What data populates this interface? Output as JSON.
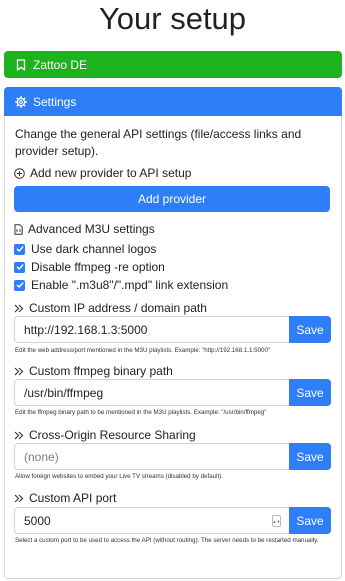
{
  "page": {
    "title": "Your setup"
  },
  "provider_card": {
    "label": "Zattoo DE",
    "icon": "bookmark-icon",
    "color": "#1db31d"
  },
  "settings_card": {
    "label": "Settings",
    "icon": "gear-icon",
    "color": "#2d7ef7",
    "description": "Change the general API settings (file/access links and provider setup).",
    "add_provider_heading": "Add new provider to API setup",
    "add_provider_button": "Add provider",
    "advanced_heading": "Advanced M3U settings",
    "checkboxes": [
      {
        "label": "Use dark channel logos",
        "checked": true
      },
      {
        "label": "Disable ffmpeg -re option",
        "checked": true
      },
      {
        "label": "Enable \".m3u8\"/\".mpd\" link extension",
        "checked": true
      }
    ],
    "fields": [
      {
        "heading": "Custom IP address / domain path",
        "value": "http://192.168.1.3:5000",
        "placeholder": "",
        "button": "Save",
        "help": "Edit the web address/port mentioned in the M3U playlists. Example: \"http://192.168.1.1:5000\""
      },
      {
        "heading": "Custom ffmpeg binary path",
        "value": "/usr/bin/ffmpeg",
        "placeholder": "",
        "button": "Save",
        "help": "Edit the ffmpeg binary path to be mentioned in the M3U playlists. Example: \"/usr/bin/ffmpeg\""
      },
      {
        "heading": "Cross-Origin Resource Sharing",
        "value": "",
        "placeholder": "(none)",
        "button": "Save",
        "help": "Allow foreign websites to embed your Live TV streams (disabled by default)."
      },
      {
        "heading": "Custom API port",
        "value": "5000",
        "placeholder": "",
        "button": "Save",
        "help": "Select a custom port to be used to access the API (without routing). The server needs to be restarted manually."
      }
    ]
  }
}
